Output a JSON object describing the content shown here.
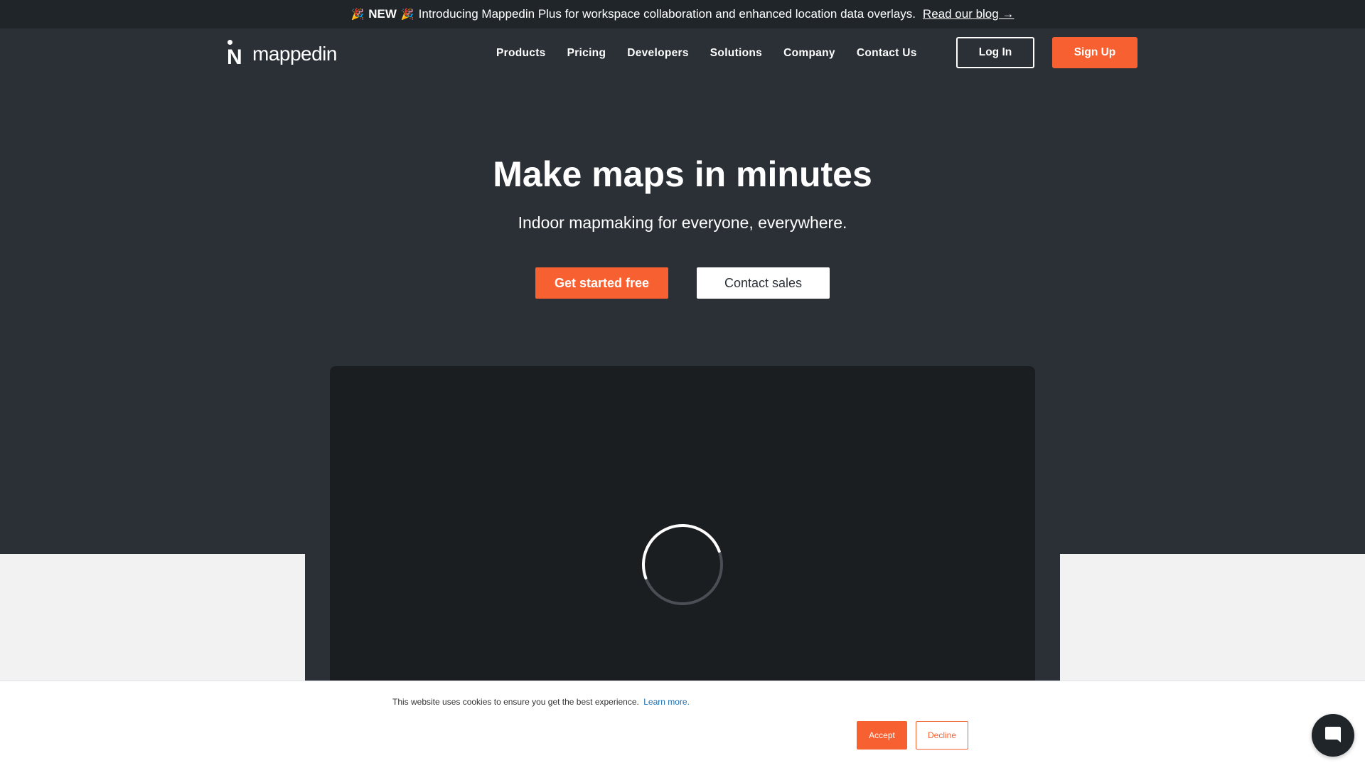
{
  "announcement": {
    "party_icon": "🎉",
    "badge": "NEW",
    "message": "Introducing Mappedin Plus for workspace collaboration and enhanced location data overlays.",
    "link": "Read our blog →"
  },
  "logo": {
    "text": "mappedin",
    "mark": "N"
  },
  "nav": {
    "items": [
      "Products",
      "Pricing",
      "Developers",
      "Solutions",
      "Company",
      "Contact Us"
    ],
    "login": "Log In",
    "signup": "Sign Up"
  },
  "hero": {
    "title": "Make maps in minutes",
    "subtitle": "Indoor mapmaking for everyone, everywhere.",
    "primary_cta": "Get started free",
    "secondary_cta": "Contact sales"
  },
  "cookie": {
    "text": "This website uses cookies to ensure you get the best experience.",
    "learn_more": "Learn more.",
    "accept": "Accept",
    "decline": "Decline"
  },
  "colors": {
    "accent": "#f76132",
    "hero_bg": "#2b3036",
    "announce_bg": "#20252a",
    "video_bg": "#1b1e21"
  },
  "icons": {
    "spinner": "loading-spinner-icon",
    "chat": "chat-bubble-icon"
  }
}
